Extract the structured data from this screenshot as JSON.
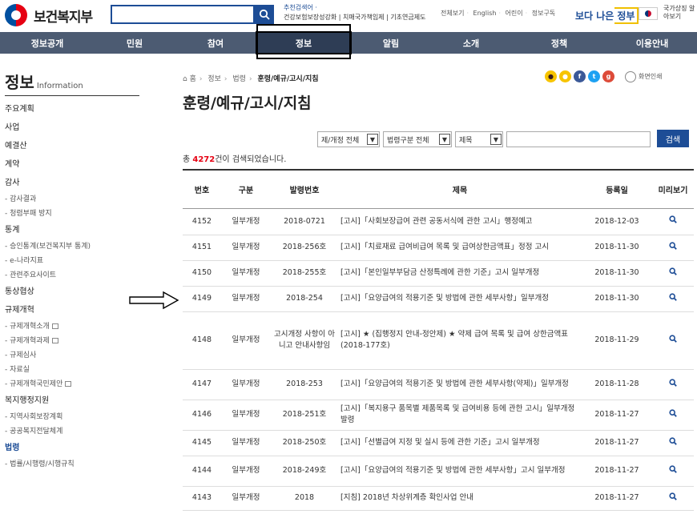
{
  "header": {
    "site_name": "보건복지부",
    "recommended_label": "추천검색어 ·",
    "recommended_terms": "건강보험보장성강화 | 치매국가책임제 | 기초연금제도",
    "util_links": [
      "전체보기",
      "English",
      "어린이",
      "정보구독"
    ],
    "gov_brand": "보다 나은",
    "gov_brand_box": "정부",
    "gov_side": "국가상징 알아보기"
  },
  "nav": [
    "정보공개",
    "민원",
    "참여",
    "정보",
    "알림",
    "소개",
    "정책",
    "이용안내"
  ],
  "sidebar": {
    "title": "정보",
    "title_en": "Information",
    "items": [
      {
        "label": "주요계획",
        "type": "main"
      },
      {
        "label": "사업",
        "type": "main"
      },
      {
        "label": "예결산",
        "type": "main"
      },
      {
        "label": "계약",
        "type": "main"
      },
      {
        "label": "감사",
        "type": "main"
      },
      {
        "label": "- 감사결과",
        "type": "sub"
      },
      {
        "label": "- 청렴부패 방지",
        "type": "sub"
      },
      {
        "label": "통계",
        "type": "main"
      },
      {
        "label": "- 승인통계(보건복지부 통계)",
        "type": "sub"
      },
      {
        "label": "- e-나라지표",
        "type": "sub"
      },
      {
        "label": "- 관련주요사이트",
        "type": "sub"
      },
      {
        "label": "통상협상",
        "type": "main"
      },
      {
        "label": "규제개혁",
        "type": "main"
      },
      {
        "label": "- 규제개혁소개",
        "type": "sub",
        "ext": true
      },
      {
        "label": "- 규제개혁과제",
        "type": "sub",
        "ext": true
      },
      {
        "label": "- 규제심사",
        "type": "sub"
      },
      {
        "label": "- 자료실",
        "type": "sub"
      },
      {
        "label": "- 규제개혁국민제안",
        "type": "sub",
        "ext": true
      },
      {
        "label": "복지행정지원",
        "type": "main"
      },
      {
        "label": "- 지역사회보장계획",
        "type": "sub"
      },
      {
        "label": "- 공공복지전달체계",
        "type": "sub"
      },
      {
        "label": "법령",
        "type": "main",
        "active": true
      },
      {
        "label": "- 법률/시행령/시행규칙",
        "type": "sub"
      }
    ]
  },
  "breadcrumb": {
    "home": "홈",
    "items": [
      "정보",
      "법령"
    ],
    "current": "훈령/예규/고시/지침"
  },
  "page_title": "훈령/예규/고시/지침",
  "share": {
    "print_label": "화면인쇄"
  },
  "filters": {
    "type": "제/개정 전체",
    "category": "법령구분 전체",
    "field": "제목",
    "search_button": "검색"
  },
  "result": {
    "prefix": "총 ",
    "count": "4272",
    "suffix": "건이 검색되었습니다."
  },
  "table": {
    "headers": [
      "번호",
      "구분",
      "발령번호",
      "제목",
      "등록일",
      "미리보기"
    ],
    "rows": [
      {
        "no": "4152",
        "kind": "일부개정",
        "code": "2018-0721",
        "title": "[고시]「사회보장급여 관련 공동서식에 관한 고시」행정예고",
        "date": "2018-12-03"
      },
      {
        "no": "4151",
        "kind": "일부개정",
        "code": "2018-256호",
        "title": "[고시]「치료재료 급여비급여 목록 및 급여상한금액표」정정 고시",
        "date": "2018-11-30"
      },
      {
        "no": "4150",
        "kind": "일부개정",
        "code": "2018-255호",
        "title": "[고시]「본인일부부담금 산정특례에 관한 기준」고시 일부개정",
        "date": "2018-11-30"
      },
      {
        "no": "4149",
        "kind": "일부개정",
        "code": "2018-254",
        "title": "[고시]「요양급여의 적용기준 및 방법에 관한 세부사항」일부개정",
        "date": "2018-11-30"
      },
      {
        "no": "4148",
        "kind": "일부개정",
        "code": "고시개정 사항이 아니고 안내사항임",
        "title": "[고시] ★ (집행정지 안내-정안제) ★ 약제 급여 목록 및 급여 상한금액표(2018-177호)",
        "date": "2018-11-29"
      },
      {
        "no": "4147",
        "kind": "일부개정",
        "code": "2018-253",
        "title": "[고시]「요양급여의 적용기준 및 방법에 관한 세부사항(약제)」일부개정",
        "date": "2018-11-28"
      },
      {
        "no": "4146",
        "kind": "일부개정",
        "code": "2018-251호",
        "title": "[고시]「복지용구 품목별 제품목록 및 급여비용 등에 관한 고시」일부개정 발령",
        "date": "2018-11-27"
      },
      {
        "no": "4145",
        "kind": "일부개정",
        "code": "2018-250호",
        "title": "[고시]「선별급여 지정 및 실시 등에 관한 기준」고시 일부개정",
        "date": "2018-11-27"
      },
      {
        "no": "4144",
        "kind": "일부개정",
        "code": "2018-249호",
        "title": "[고시]「요양급여의 적용기준 및 방법에 관한 세부사항」고시 일부개정",
        "date": "2018-11-27"
      },
      {
        "no": "4143",
        "kind": "일부개정",
        "code": "2018",
        "title": "[지침] 2018년 차상위계층 확인사업 안내",
        "date": "2018-11-27"
      }
    ]
  },
  "colors": {
    "brand_blue": "#1d4d96",
    "nav_bg": "#4c5b72",
    "count_red": "#e60012"
  }
}
